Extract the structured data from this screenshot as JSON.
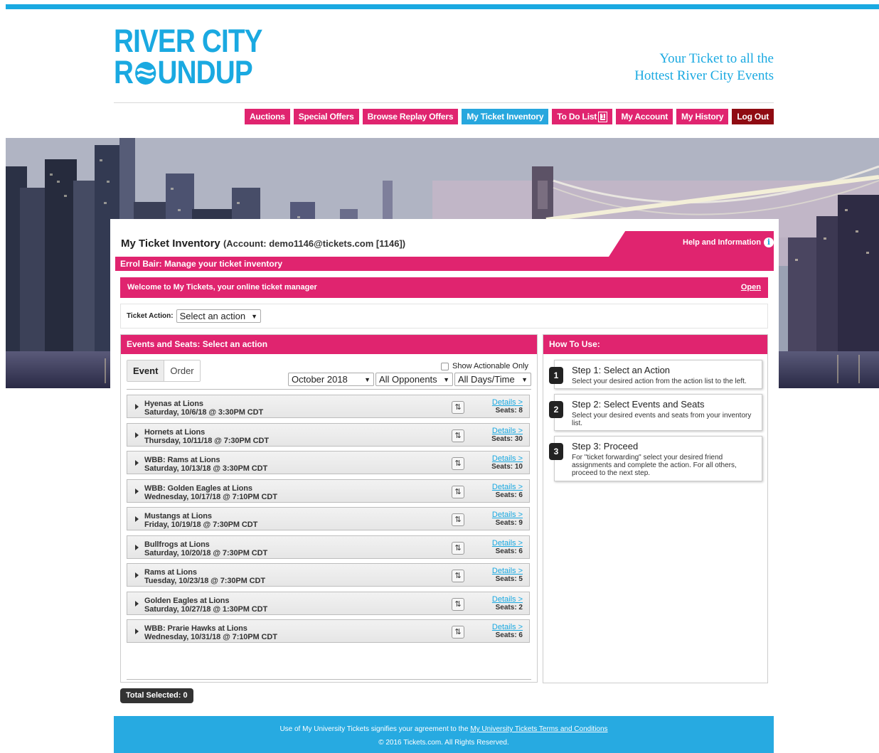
{
  "brand": {
    "logo_line1": "RIVER CITY",
    "logo_line2_pre": "R",
    "logo_line2_post": "UNDUP",
    "tagline_line1": "Your Ticket to all the",
    "tagline_line2": "Hottest River City Events",
    "accent": "#1aa9e1",
    "pink": "#e0246f",
    "dark_red": "#8f0b12"
  },
  "nav": {
    "auctions": "Auctions",
    "special_offers": "Special Offers",
    "browse_replay": "Browse Replay Offers",
    "my_ticket_inventory": "My Ticket Inventory",
    "to_do_list": "To Do List",
    "to_do_count": "1",
    "my_account": "My Account",
    "my_history": "My History",
    "log_out": "Log Out"
  },
  "inventory": {
    "title": "My Ticket Inventory",
    "account": "(Account: demo1146@tickets.com [1146])",
    "help": "Help and Information",
    "manage": "Errol Bair: Manage your ticket inventory",
    "welcome": "Welcome to My Tickets, your online ticket manager",
    "open": "Open",
    "ticket_action_label": "Ticket Action:",
    "ticket_action_value": "Select an action"
  },
  "events": {
    "header": "Events and Seats: Select an action",
    "tab_event": "Event",
    "tab_order": "Order",
    "show_actionable": "Show Actionable Only",
    "filter_month": "October 2018",
    "filter_opponents": "All Opponents",
    "filter_days": "All Days/Time",
    "details_label": "Details >",
    "rows": [
      {
        "name": "Hyenas at Lions",
        "date": "Saturday, 10/6/18 @ 3:30PM CDT",
        "seats": "Seats: 8"
      },
      {
        "name": "Hornets at Lions",
        "date": "Thursday, 10/11/18 @ 7:30PM CDT",
        "seats": "Seats: 30"
      },
      {
        "name": "WBB: Rams at Lions",
        "date": "Saturday, 10/13/18 @ 3:30PM CDT",
        "seats": "Seats: 10"
      },
      {
        "name": "WBB: Golden Eagles at Lions",
        "date": "Wednesday, 10/17/18 @ 7:10PM CDT",
        "seats": "Seats: 6"
      },
      {
        "name": "Mustangs at Lions",
        "date": "Friday, 10/19/18 @ 7:30PM CDT",
        "seats": "Seats: 9"
      },
      {
        "name": "Bullfrogs at Lions",
        "date": "Saturday, 10/20/18 @ 7:30PM CDT",
        "seats": "Seats: 6"
      },
      {
        "name": "Rams at Lions",
        "date": "Tuesday, 10/23/18 @ 7:30PM CDT",
        "seats": "Seats: 5"
      },
      {
        "name": "Golden Eagles at Lions",
        "date": "Saturday, 10/27/18 @ 1:30PM CDT",
        "seats": "Seats: 2"
      },
      {
        "name": "WBB: Prarie Hawks at Lions",
        "date": "Wednesday, 10/31/18 @ 7:10PM CDT",
        "seats": "Seats: 6"
      }
    ]
  },
  "howto": {
    "header": "How To Use:",
    "steps": [
      {
        "num": "1",
        "title": "Step 1: Select an Action",
        "desc": "Select your desired action from the action list to the left."
      },
      {
        "num": "2",
        "title": "Step 2: Select Events and Seats",
        "desc": "Select your desired events and seats from your inventory list."
      },
      {
        "num": "3",
        "title": "Step 3: Proceed",
        "desc": "For \"ticket forwarding\" select your desired friend assignments and complete the action. For all others, proceed to the next step."
      }
    ]
  },
  "total_selected": "Total Selected: 0",
  "footer": {
    "line1_pre": "Use of My University Tickets signifies your agreement to the ",
    "line1_link": "My University Tickets Terms and Conditions",
    "line2": "© 2016 Tickets.com. All Rights Reserved."
  }
}
